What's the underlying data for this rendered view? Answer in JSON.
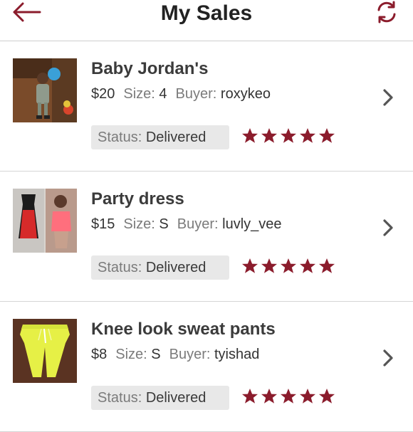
{
  "header": {
    "title": "My Sales",
    "back_icon": "arrow-left-icon",
    "refresh_icon": "refresh-icon",
    "accent_color": "#8b1c2c"
  },
  "labels": {
    "size": "Size:",
    "buyer": "Buyer:",
    "status": "Status:"
  },
  "items": [
    {
      "title": "Baby Jordan's",
      "price": "$20",
      "size": "4",
      "buyer": "roxykeo",
      "status": "Delivered",
      "rating": 5
    },
    {
      "title": "Party dress",
      "price": "$15",
      "size": "S",
      "buyer": "luvly_vee",
      "status": "Delivered",
      "rating": 5
    },
    {
      "title": "Knee look sweat pants",
      "price": "$8",
      "size": "S",
      "buyer": "tyishad",
      "status": "Delivered",
      "rating": 5
    }
  ]
}
